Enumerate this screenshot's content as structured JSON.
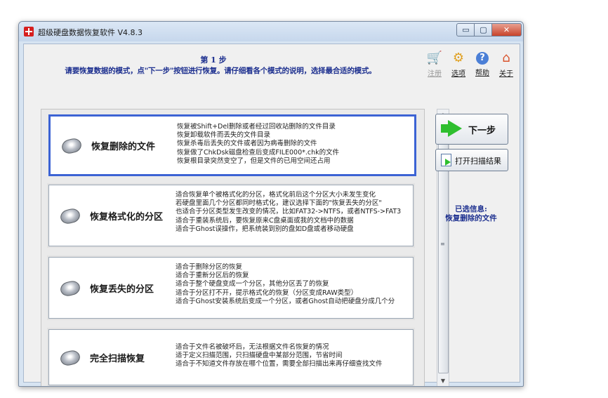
{
  "window": {
    "title": "超级硬盘数据恢复软件 V4.8.3",
    "minimize_glyph": "▭",
    "maximize_glyph": "▢",
    "close_glyph": "✕"
  },
  "header": {
    "step_title": "第 1 步",
    "step_desc": "请要恢复数据的模式，点\"下一步\"按钮进行恢复。请仔细看各个模式的说明，选择最合适的模式。"
  },
  "toolbar": {
    "register": {
      "label": "注册",
      "icon": "cart-icon",
      "glyph": "🛒",
      "enabled": false
    },
    "options": {
      "label": "选项",
      "icon": "gear-icon",
      "glyph": "⚙",
      "enabled": true
    },
    "help": {
      "label": "帮助",
      "icon": "help-icon",
      "glyph": "?",
      "enabled": true
    },
    "about": {
      "label": "关于",
      "icon": "home-icon",
      "glyph": "⌂",
      "enabled": true
    }
  },
  "modes": [
    {
      "name": "恢复删除的文件",
      "selected": true,
      "lines": [
        "恢复被Shift+Del删除或者经过回收站删除的文件目录",
        "恢复卸载软件而丢失的文件目录",
        "恢复杀毒后丢失的文件或者因为病毒删除的文件",
        "恢复做了ChkDsk磁盘检查后变成FILE000*.chk的文件",
        "恢复根目录突然变空了，但是文件的已用空间还占用"
      ]
    },
    {
      "name": "恢复格式化的分区",
      "selected": false,
      "lines": [
        "适合恢复单个被格式化的分区，格式化前后这个分区大小未发生变化",
        "若硬盘里面几个分区都同时格式化，建议选择下面的\"恢复丢失的分区\"",
        "也适合于分区类型发生改变的情况，比如FAT32->NTFS，或者NTFS->FAT3",
        "适合于重装系统后，要恢复原来C盘桌面或我的文档中的数据",
        "适合于Ghost误操作，把系统装到别的盘如D盘或者移动硬盘"
      ]
    },
    {
      "name": "恢复丢失的分区",
      "selected": false,
      "lines": [
        "适合于删除分区的恢复",
        "适合于重新分区后的恢复",
        "适合于整个硬盘变成一个分区，其他分区丢了的恢复",
        "适合于分区打不开，提示格式化的恢复（分区变成RAW类型）",
        "适合于Ghost安装系统后变成一个分区，或者Ghost自动把硬盘分成几个分"
      ]
    },
    {
      "name": "完全扫描恢复",
      "selected": false,
      "lines": [
        "适合于文件名被破坏后，无法根据文件名恢复的情况",
        "适于定义扫描范围，只扫描硬盘中某部分范围，节省时间",
        "适合于不知道文件存放在哪个位置，需要全部扫描出来再仔细查找文件"
      ]
    }
  ],
  "side": {
    "next_label": "下一步",
    "open_scan_label": "打开扫描结果",
    "selected_info_title": "已选信息:",
    "selected_info_value": "恢复删除的文件"
  },
  "scrollbar": {
    "up_glyph": "▲",
    "down_glyph": "▼",
    "grip_glyph": "≡"
  }
}
